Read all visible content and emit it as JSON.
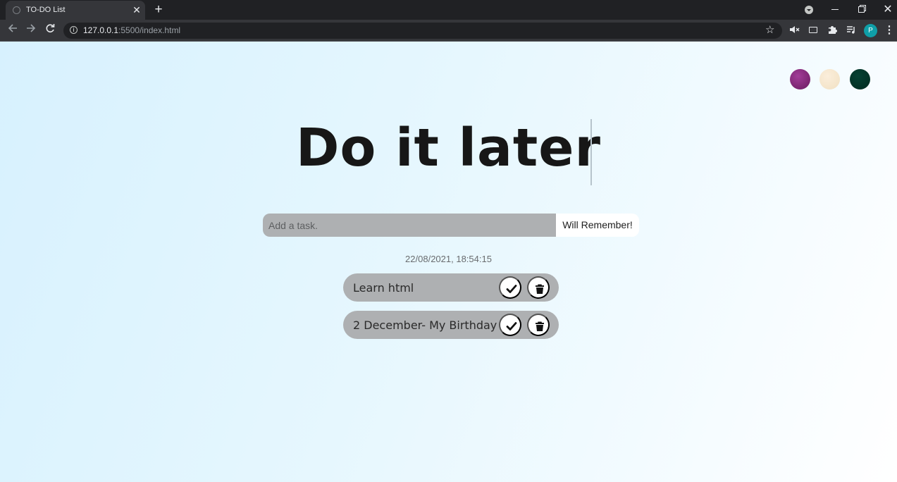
{
  "browser": {
    "tab_title": "TO-DO List",
    "tab_close": "✕",
    "new_tab": "+",
    "url_host": "127.0.0.1",
    "url_rest": ":5500/index.html",
    "profile_initial": "P",
    "icons": {
      "back": "arrow-left-icon",
      "forward": "arrow-right-icon",
      "reload": "reload-icon",
      "site_info": "info-icon",
      "bookmark": "star-icon",
      "mute": "mute-icon",
      "cast": "cast-icon",
      "extensions": "puzzle-icon",
      "media": "media-queue-icon",
      "menu": "kebab-menu-icon"
    },
    "colors": {
      "frame": "#202124",
      "toolbar": "#35363a",
      "profile": "#0f9fa8"
    }
  },
  "page": {
    "theme_colors": {
      "standard": "#8a2b80",
      "light": "#f7e8d0",
      "darker": "#033527"
    },
    "title": "Do it later",
    "input": {
      "placeholder": "Add a task.",
      "value": ""
    },
    "submit_label": "Will Remember!",
    "datetime": "22/08/2021, 18:54:15",
    "todos": [
      {
        "text": "Learn html"
      },
      {
        "text": "2 December- My Birthday"
      }
    ]
  }
}
